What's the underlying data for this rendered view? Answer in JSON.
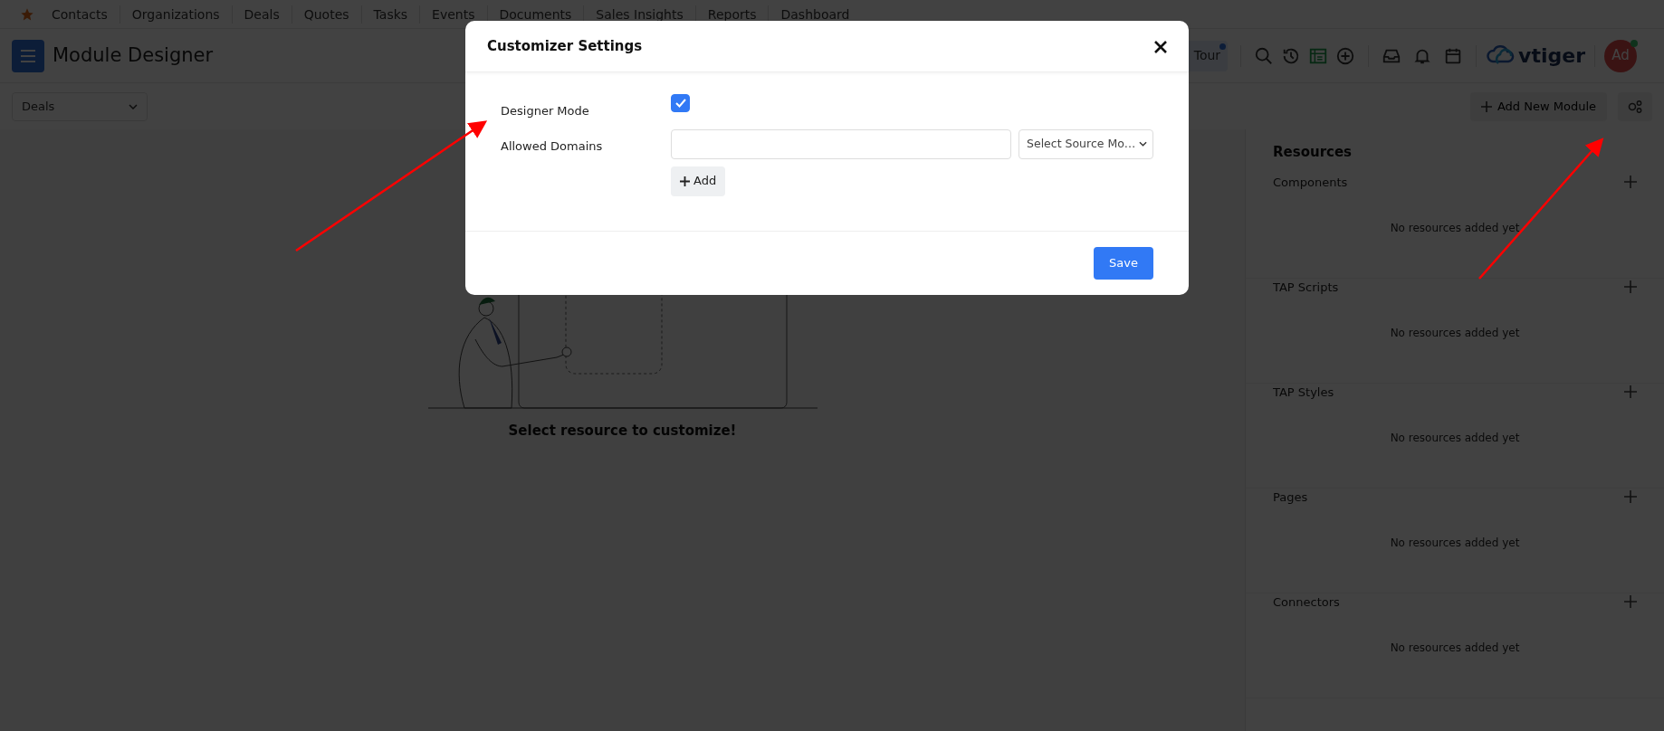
{
  "top_nav": {
    "items": [
      "Contacts",
      "Organizations",
      "Deals",
      "Quotes",
      "Tasks",
      "Events",
      "Documents",
      "Sales Insights",
      "Reports",
      "Dashboard"
    ]
  },
  "header": {
    "title": "Module Designer",
    "tour": "Tour",
    "logo": "vtiger",
    "avatar": "Ad"
  },
  "toolbar": {
    "module_select": "Deals",
    "add_button": "Add New Module"
  },
  "empty_state": {
    "message": "Select resource to customize!"
  },
  "resources": {
    "title": "Resources",
    "sections": [
      {
        "name": "Components",
        "empty": "No resources added yet"
      },
      {
        "name": "TAP Scripts",
        "empty": "No resources added yet"
      },
      {
        "name": "TAP Styles",
        "empty": "No resources added yet"
      },
      {
        "name": "Pages",
        "empty": "No resources added yet"
      },
      {
        "name": "Connectors",
        "empty": "No resources added yet"
      }
    ]
  },
  "modal": {
    "title": "Customizer Settings",
    "fields": [
      {
        "kind": "checkbox",
        "label": "Designer Mode",
        "checked": true
      },
      {
        "kind": "domains",
        "label": "Allowed Domains",
        "select": "Select Source Mo…",
        "add": "Add"
      }
    ],
    "save": "Save"
  }
}
